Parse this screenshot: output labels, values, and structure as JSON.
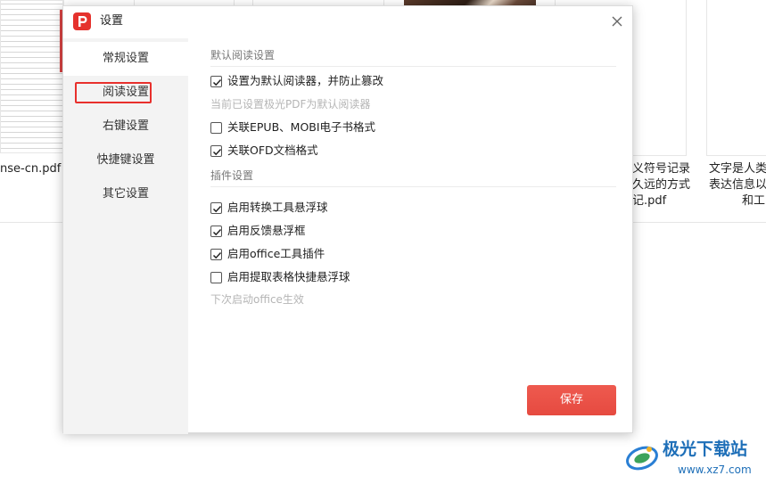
{
  "background": {
    "files": [
      {
        "name": "nse-cn.pdf"
      },
      {
        "name_lines": [
          "义符号记录",
          "久远的方式",
          "记.pdf"
        ]
      },
      {
        "name_lines": [
          "文字是人类",
          "表达信息以",
          "和工"
        ]
      }
    ]
  },
  "dialog": {
    "title": "设置",
    "close_icon": "close-icon",
    "sidebar": {
      "items": [
        {
          "label": "常规设置"
        },
        {
          "label": "阅读设置"
        },
        {
          "label": "右键设置"
        },
        {
          "label": "快捷键设置"
        },
        {
          "label": "其它设置"
        }
      ],
      "active_index": 1
    },
    "sections": {
      "reading": {
        "title": "默认阅读设置",
        "options": [
          {
            "label": "设置为默认阅读器，并防止篡改",
            "checked": true
          },
          {
            "label": "关联EPUB、MOBI电子书格式",
            "checked": false
          },
          {
            "label": "关联OFD文档格式",
            "checked": true
          }
        ],
        "status_hint": "当前已设置极光PDF为默认阅读器"
      },
      "plugins": {
        "title": "插件设置",
        "options": [
          {
            "label": "启用转换工具悬浮球",
            "checked": true
          },
          {
            "label": "启用反馈悬浮框",
            "checked": true
          },
          {
            "label": "启用office工具插件",
            "checked": true
          },
          {
            "label": "启用提取表格快捷悬浮球",
            "checked": false
          }
        ],
        "restart_hint": "下次启动office生效"
      }
    },
    "save_label": "保存",
    "colors": {
      "accent": "#e8493f",
      "highlight_border": "#e8302c",
      "sidebar_bg": "#f3f3f3"
    }
  },
  "watermark": {
    "title": "极光下载站",
    "url": "www.xz7.com"
  }
}
